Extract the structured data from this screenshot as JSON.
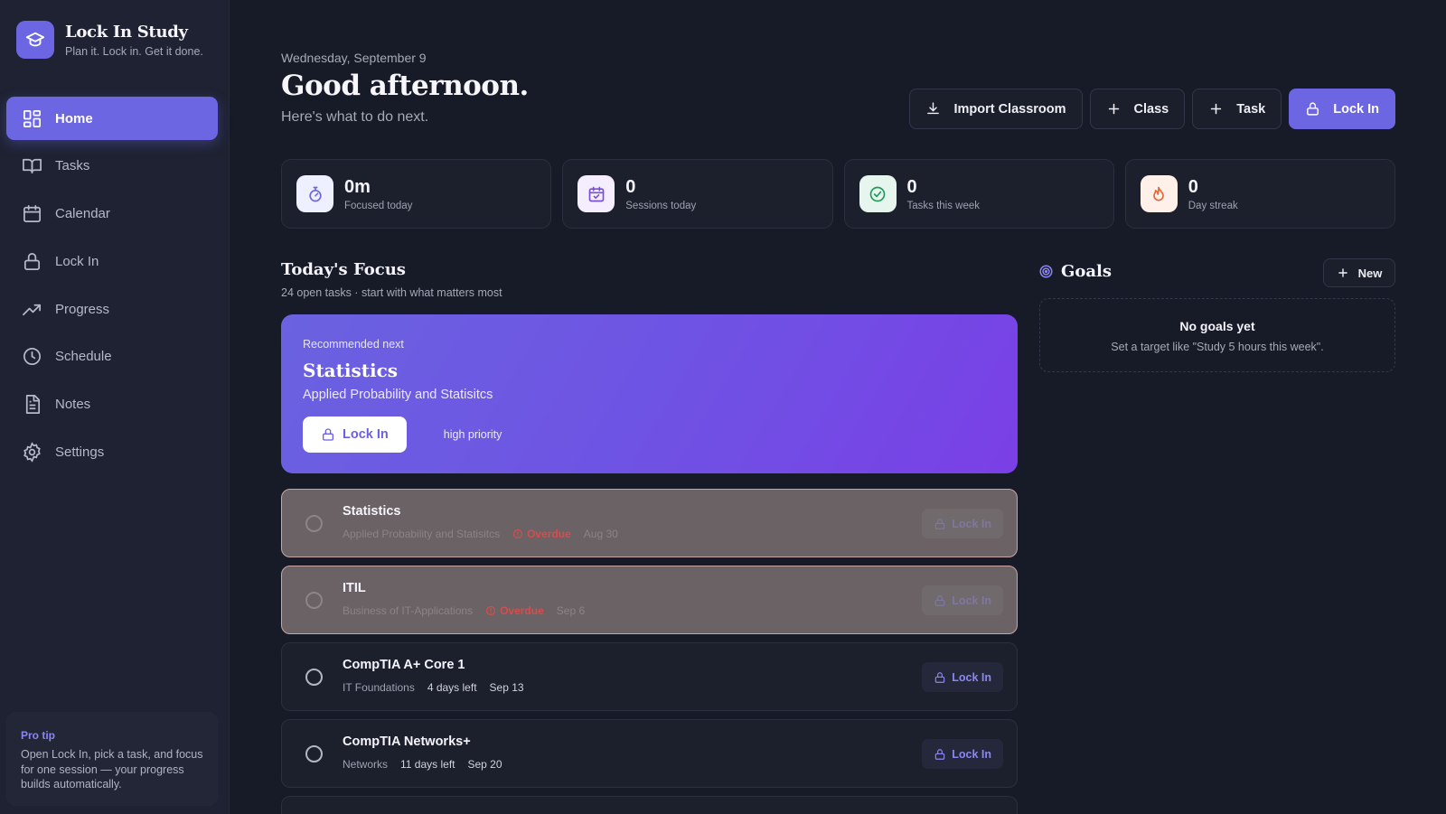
{
  "brand": {
    "name": "Lock In Study",
    "tagline": "Plan it. Lock in. Get it done."
  },
  "nav": [
    {
      "label": "Home",
      "icon": "grid-icon",
      "active": true
    },
    {
      "label": "Tasks",
      "icon": "book-icon"
    },
    {
      "label": "Calendar",
      "icon": "calendar-icon"
    },
    {
      "label": "Lock In",
      "icon": "lock-icon"
    },
    {
      "label": "Progress",
      "icon": "trend-up-icon"
    },
    {
      "label": "Schedule",
      "icon": "clock-icon"
    },
    {
      "label": "Notes",
      "icon": "document-icon"
    },
    {
      "label": "Settings",
      "icon": "gear-icon"
    }
  ],
  "pro_tip": {
    "title": "Pro tip",
    "text": "Open Lock In, pick a task, and focus for one session — your progress builds automatically."
  },
  "header": {
    "date": "Wednesday, September 9",
    "greeting": "Good afternoon.",
    "subtitle": "Here's what to do next."
  },
  "actions": {
    "import": "Import Classroom",
    "class": "Class",
    "task": "Task",
    "lock_in": "Lock In"
  },
  "stats": [
    {
      "value": "0m",
      "label": "Focused today",
      "icon": "stopwatch-icon",
      "bg": "#eef0ff",
      "fg": "#6d66e3"
    },
    {
      "value": "0",
      "label": "Sessions today",
      "icon": "calendar-check-icon",
      "bg": "#f4eefe",
      "fg": "#7a4fd8"
    },
    {
      "value": "0",
      "label": "Tasks this week",
      "icon": "check-circle-icon",
      "bg": "#e6f6ee",
      "fg": "#1f9a5b"
    },
    {
      "value": "0",
      "label": "Day streak",
      "icon": "flame-icon",
      "bg": "#fff1ea",
      "fg": "#e0683a"
    }
  ],
  "focus": {
    "title": "Today's Focus",
    "subtitle": "24 open tasks · start with what matters most"
  },
  "recommended": {
    "kicker": "Recommended next",
    "title": "Statistics",
    "subtitle": "Applied Probability and Statisitcs",
    "button": "Lock In",
    "priority": "high priority"
  },
  "tasks": [
    {
      "name": "Statistics",
      "course": "Applied Probability and Statisitcs",
      "status": "Overdue",
      "date": "Aug 30",
      "button": "Lock In"
    },
    {
      "name": "ITIL",
      "course": "Business of IT-Applications",
      "status": "Overdue",
      "date": "Sep 6",
      "button": "Lock In"
    },
    {
      "name": "CompTIA A+ Core 1",
      "course": "IT Foundations",
      "status": "4 days left",
      "date": "Sep 13",
      "button": "Lock In"
    },
    {
      "name": "CompTIA Networks+",
      "course": "Networks",
      "status": "11 days left",
      "date": "Sep 20",
      "button": "Lock In"
    }
  ],
  "goals": {
    "title": "Goals",
    "new_label": "New",
    "empty_title": "No goals yet",
    "empty_text": "Set a target like \"Study 5 hours this week\"."
  },
  "colors": {
    "accent": "#6d66e3",
    "overdue": "#d64d4d",
    "background": "#171a27",
    "sidebar": "#1e2232"
  }
}
